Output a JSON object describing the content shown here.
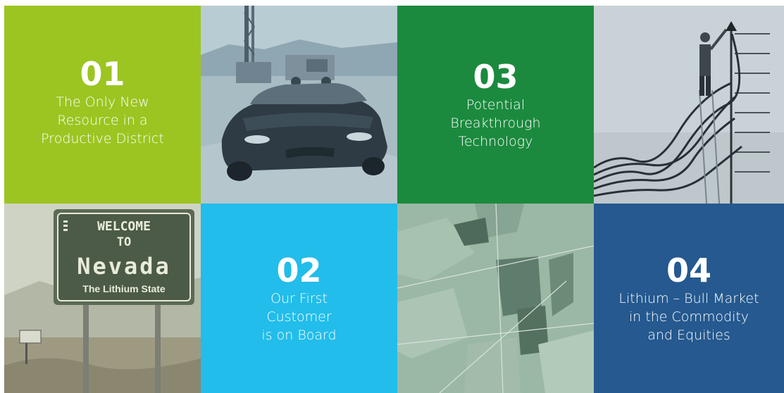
{
  "colors": {
    "tile_01": "#9cc521",
    "tile_02": "#22bdea",
    "tile_03": "#1b8a3e",
    "tile_04": "#25598f"
  },
  "tiles": [
    {
      "number": "01",
      "caption": "The Only New\nResource in a\nProductive District"
    },
    {
      "number": "02",
      "caption": "Our First\nCustomer\nis on Board"
    },
    {
      "number": "03",
      "caption": "Potential\nBreakthrough\nTechnology"
    },
    {
      "number": "04",
      "caption": "Lithium – Bull Market\nin the Commodity\nand Equities"
    }
  ],
  "images": {
    "car_drilling": "car-at-drill-site-photo",
    "rising_chart": "man-drawing-rising-lines-photo",
    "nevada_sign": {
      "line1": "WELCOME",
      "line2": "TO",
      "line3": "Nevada",
      "line4": "The Lithium State"
    },
    "aerial": "aerial-evaporation-ponds-photo"
  }
}
